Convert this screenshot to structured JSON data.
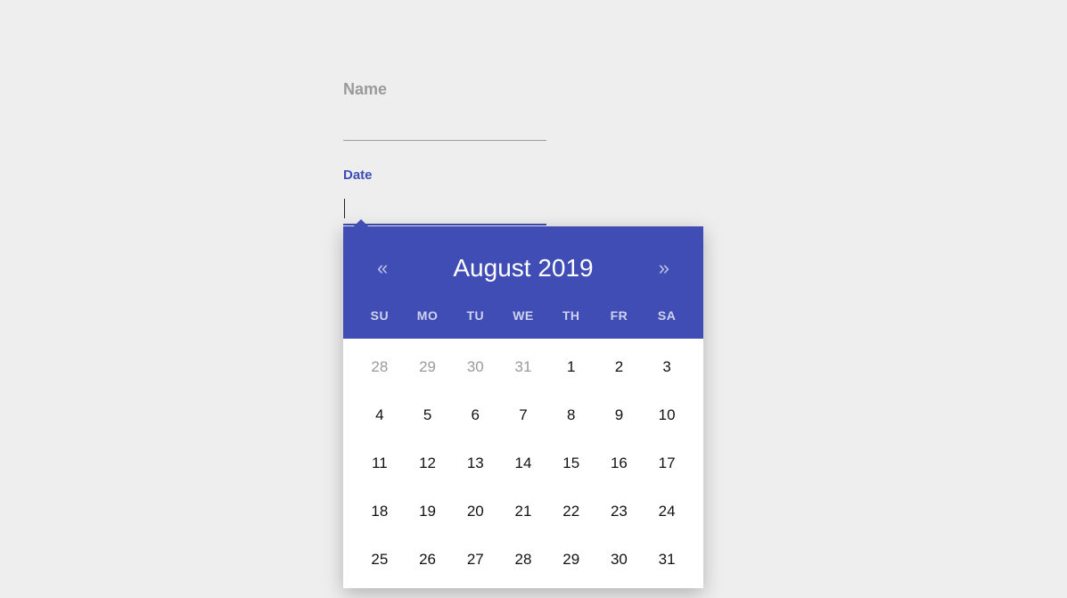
{
  "form": {
    "name_label": "Name",
    "name_value": "",
    "date_label": "Date",
    "date_value": ""
  },
  "datepicker": {
    "prev_glyph": "«",
    "next_glyph": "»",
    "title": "August 2019",
    "weekdays": [
      "SU",
      "MO",
      "TU",
      "WE",
      "TH",
      "FR",
      "SA"
    ],
    "weeks": [
      [
        {
          "d": "28",
          "other": true
        },
        {
          "d": "29",
          "other": true
        },
        {
          "d": "30",
          "other": true
        },
        {
          "d": "31",
          "other": true
        },
        {
          "d": "1",
          "other": false
        },
        {
          "d": "2",
          "other": false
        },
        {
          "d": "3",
          "other": false
        }
      ],
      [
        {
          "d": "4",
          "other": false
        },
        {
          "d": "5",
          "other": false
        },
        {
          "d": "6",
          "other": false
        },
        {
          "d": "7",
          "other": false
        },
        {
          "d": "8",
          "other": false
        },
        {
          "d": "9",
          "other": false
        },
        {
          "d": "10",
          "other": false
        }
      ],
      [
        {
          "d": "11",
          "other": false
        },
        {
          "d": "12",
          "other": false
        },
        {
          "d": "13",
          "other": false
        },
        {
          "d": "14",
          "other": false
        },
        {
          "d": "15",
          "other": false
        },
        {
          "d": "16",
          "other": false
        },
        {
          "d": "17",
          "other": false
        }
      ],
      [
        {
          "d": "18",
          "other": false
        },
        {
          "d": "19",
          "other": false
        },
        {
          "d": "20",
          "other": false
        },
        {
          "d": "21",
          "other": false
        },
        {
          "d": "22",
          "other": false
        },
        {
          "d": "23",
          "other": false
        },
        {
          "d": "24",
          "other": false
        }
      ],
      [
        {
          "d": "25",
          "other": false
        },
        {
          "d": "26",
          "other": false
        },
        {
          "d": "27",
          "other": false
        },
        {
          "d": "28",
          "other": false
        },
        {
          "d": "29",
          "other": false
        },
        {
          "d": "30",
          "other": false
        },
        {
          "d": "31",
          "other": false
        }
      ]
    ]
  }
}
